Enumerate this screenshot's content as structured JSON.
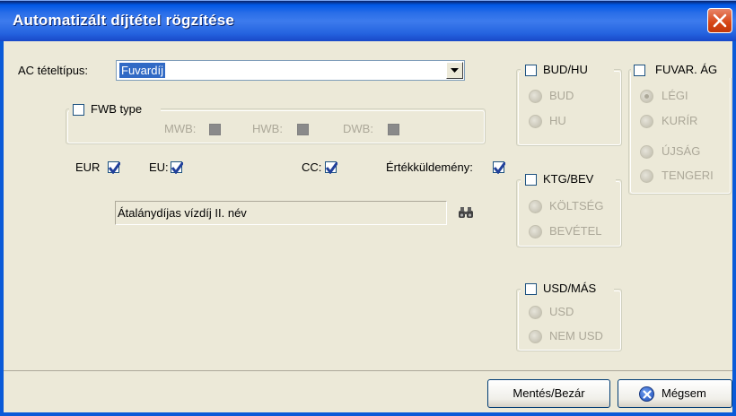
{
  "window": {
    "title": "Automatizált díjtétel rögzítése"
  },
  "ac_type": {
    "label": "AC tételtípus:",
    "value": "Fuvardíj"
  },
  "fwb": {
    "label": "FWB type",
    "mwb": "MWB:",
    "hwb": "HWB:",
    "dwb": "DWB:"
  },
  "flags": {
    "eur": "EUR",
    "eu": "EU:",
    "cc": "CC:",
    "value_consignment": "Értékküldemény:"
  },
  "description": "Átalánydíjas vízdíj  II. név",
  "bud_hu": {
    "label": "BUD/HU",
    "options": [
      "BUD",
      "HU"
    ]
  },
  "fuvar_ag": {
    "label": "FUVAR. ÁG",
    "options": [
      "LÉGI",
      "KURÍR",
      "ÚJSÁG",
      "TENGERI"
    ]
  },
  "ktg_bev": {
    "label": "KTG/BEV",
    "options": [
      "KÖLTSÉG",
      "BEVÉTEL"
    ]
  },
  "usd_mas": {
    "label": "USD/MÁS",
    "options": [
      "USD",
      "NEM USD"
    ]
  },
  "buttons": {
    "save_close": "Mentés/Bezár",
    "cancel": "Mégsem"
  },
  "colors": {
    "titlebar": "#0058e6",
    "dialog_bg": "#ece9d8",
    "selection": "#316ac5",
    "check": "#21409a"
  }
}
